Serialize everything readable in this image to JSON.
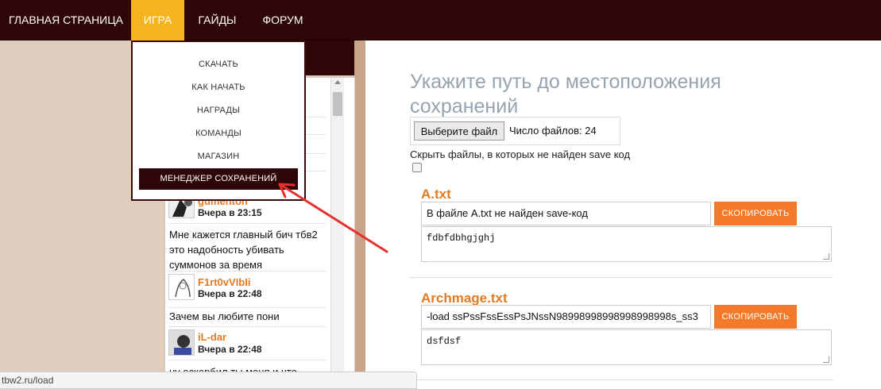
{
  "nav": {
    "items": [
      {
        "label": "ГЛАВНАЯ СТРАНИЦА",
        "active": false
      },
      {
        "label": "ИГРА",
        "active": true
      },
      {
        "label": "ГАЙДЫ",
        "active": false
      },
      {
        "label": "ФОРУМ",
        "active": false
      }
    ]
  },
  "dropdown": {
    "items": [
      {
        "label": "СКАЧАТЬ"
      },
      {
        "label": "КАК НАЧАТЬ"
      },
      {
        "label": "НАГРАДЫ"
      },
      {
        "label": "КОМАНДЫ"
      },
      {
        "label": "МАГАЗИН"
      },
      {
        "label": "МЕНЕДЖЕР СОХРАНЕНИЙ",
        "active": true
      }
    ]
  },
  "chat": {
    "messages": [
      {
        "user": "gumehton",
        "time": "Вчера в 23:15",
        "text": "Мне кажется главный бич тбв2 это надобность убивать суммонов за время"
      },
      {
        "user": "F1rt0vVIbIi",
        "time": "Вчера в 22:48",
        "text": "Зачем вы любите пони"
      },
      {
        "user": "iL-dar",
        "time": "Вчера в 22:48",
        "text": "ну оскорбил ты меня и что"
      }
    ]
  },
  "main": {
    "title": "Укажите путь до местоположения сохранений",
    "file_button": "Выберите файл",
    "file_count": "Число файлов: 24",
    "hide_label": "Скрыть файлы, в которых не найден save код",
    "copy_label": "СКОПИРОВАТЬ",
    "files": [
      {
        "name": "A.txt",
        "status": "В файле A.txt не найден save-код",
        "code": "fdbfdbhgjghj"
      },
      {
        "name": "Archmage.txt",
        "status": "-load ssPssFssEssPsJNssN98998998998998998998s_ss3",
        "code": "dsfdsf"
      }
    ]
  },
  "status_bar": {
    "text": "tbw2.ru/load"
  },
  "colors": {
    "nav_bg": "#2f0607",
    "nav_active": "#f5b41d",
    "accent_orange": "#e37a22",
    "copy_button": "#f27a2a",
    "title": "#95a4b0"
  }
}
